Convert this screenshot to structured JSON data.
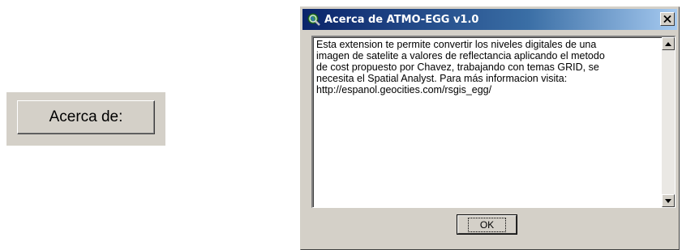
{
  "about_button": {
    "label": "Acerca de:"
  },
  "dialog": {
    "title": "Acerca de ATMO-EGG v1.0",
    "title_icon": "globe-magnifier-icon",
    "close_icon": "close-icon",
    "message": "Esta extension te permite convertir los niveles digitales de una\nimagen de satelite a valores de reflectancia aplicando el metodo\nde cost propuesto por Chavez, trabajando con temas GRID, se\nnecesita el Spatial Analyst. Para más informacion visita:\nhttp://espanol.geocities.com/rsgis_egg/",
    "ok_label": "OK"
  },
  "colors": {
    "window_face": "#d4d0c8",
    "title_gradient_start": "#0a246a",
    "title_gradient_end": "#a6caf0"
  }
}
